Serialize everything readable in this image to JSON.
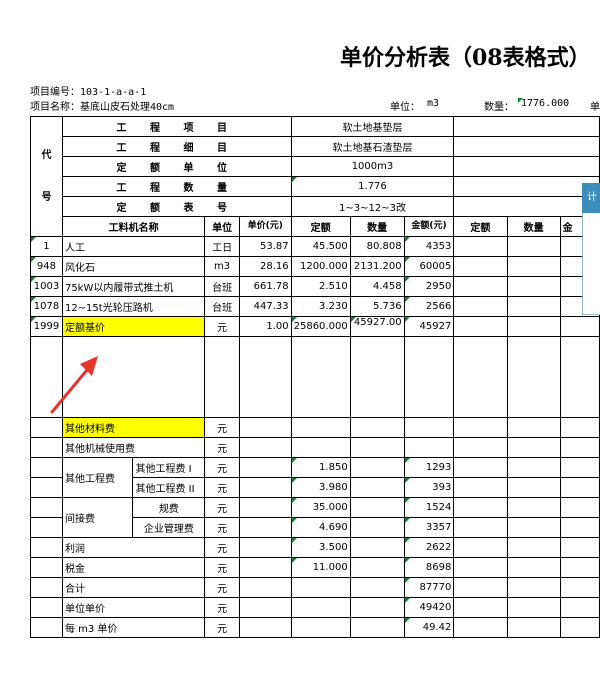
{
  "title": "单价分析表（08表格式）",
  "header": {
    "project_code": "项目编号：103-1-a-a-1",
    "project_name": "项目名称：基底山皮石处理40cm",
    "unit_label": "单位：",
    "unit_value": "m3",
    "qty_label": "数量：",
    "qty_value": "1776.000",
    "cut_label": "单"
  },
  "side_tab": "计",
  "info": {
    "col_code": "代\n\n\n号",
    "rows": [
      {
        "label": "工 程 项 目",
        "value": "软土地基垫层"
      },
      {
        "label": "工 程 细 目",
        "value": "软土地基石渣垫层"
      },
      {
        "label": "定 额 单 位",
        "value": "1000m3"
      },
      {
        "label": "工 程 数 量",
        "value": "1.776"
      },
      {
        "label": "定 额 表 号",
        "value": "1~3~12~3改"
      }
    ]
  },
  "columns": {
    "name": "工料机名称",
    "unit": "单位",
    "price": "单价(元)",
    "quota": "定额",
    "qty": "数量",
    "amount": "金额(元)",
    "quota2": "定额",
    "qty2": "数量",
    "amount2": "金"
  },
  "items": [
    {
      "code": "1",
      "name": "人工",
      "unit": "工日",
      "price": "53.87",
      "quota": "45.500",
      "qty": "80.808",
      "amount": "4353"
    },
    {
      "code": "948",
      "name": "风化石",
      "unit": "m3",
      "price": "28.16",
      "quota": "1200.000",
      "qty": "2131.200",
      "amount": "60005"
    },
    {
      "code": "1003",
      "name": "75kW以内履带式推土机",
      "unit": "台班",
      "price": "661.78",
      "quota": "2.510",
      "qty": "4.458",
      "amount": "2950"
    },
    {
      "code": "1078",
      "name": "12~15t光轮压路机",
      "unit": "台班",
      "price": "447.33",
      "quota": "3.230",
      "qty": "5.736",
      "amount": "2566"
    },
    {
      "code": "1999",
      "name": "定额基价",
      "unit": "元",
      "price": "1.00",
      "quota": "25860.000",
      "qty": "45927.00",
      "amount": "45927"
    }
  ],
  "costs": {
    "other_material": {
      "name": "其他材料费",
      "unit": "元"
    },
    "other_machine": {
      "name": "其他机械使用费",
      "unit": "元"
    },
    "other_eng": {
      "name": "其他工程费",
      "sub1": "其他工程费 I",
      "sub2": "其他工程费 II",
      "unit": "元",
      "q1": "1.850",
      "a1": "1293",
      "q2": "3.980",
      "a2": "393"
    },
    "indirect": {
      "name": "间接费",
      "sub1": "规费",
      "sub2": "企业管理费",
      "unit": "元",
      "q1": "35.000",
      "a1": "1524",
      "q2": "4.690",
      "a2": "3357"
    },
    "profit": {
      "name": "利润",
      "unit": "元",
      "quota": "3.500",
      "amount": "2622"
    },
    "tax": {
      "name": "税金",
      "unit": "元",
      "quota": "11.000",
      "amount": "8698"
    },
    "total": {
      "name": "合计",
      "unit": "元",
      "amount": "87770"
    },
    "unit_price": {
      "name": "单位单价",
      "unit": "元",
      "amount": "49420"
    },
    "per_m3": {
      "name": "每 m3 单价",
      "unit": "元",
      "amount": "49.42"
    }
  }
}
